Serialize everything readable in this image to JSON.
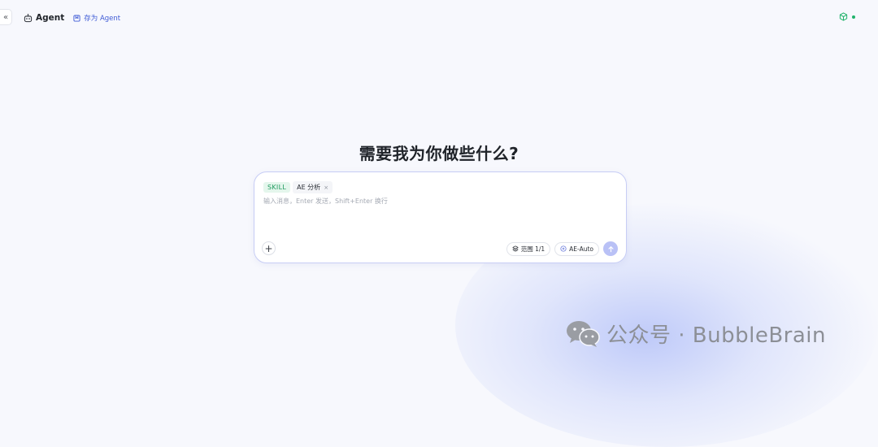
{
  "header": {
    "title": "Agent",
    "save_label": "存为 Agent"
  },
  "main": {
    "heading": "需要我为你做些什么?"
  },
  "composer": {
    "skill_tag": "SKILL",
    "skill_name": "AE 分析",
    "chip_close": "×",
    "placeholder": "输入消息，Enter 发送，Shift+Enter 换行",
    "value": "",
    "scope_label": "范围 1/1",
    "model_label": "AE-Auto"
  },
  "watermark": {
    "text": "公众号 · BubbleBrain"
  },
  "icons": {
    "collapse": "double-chevron-left-icon",
    "agent": "robot-icon",
    "save": "bookmark-icon",
    "package": "package-icon",
    "add": "plus-icon",
    "scope": "layers-icon",
    "model": "sparkle-icon",
    "send": "arrow-up-icon",
    "wechat": "wechat-icon"
  },
  "colors": {
    "accent": "#3f5bd6",
    "skill_green": "#1f9a5e",
    "status_green": "#20b26b",
    "send_button": "#b9c1f6",
    "border": "#c7cdf5"
  }
}
